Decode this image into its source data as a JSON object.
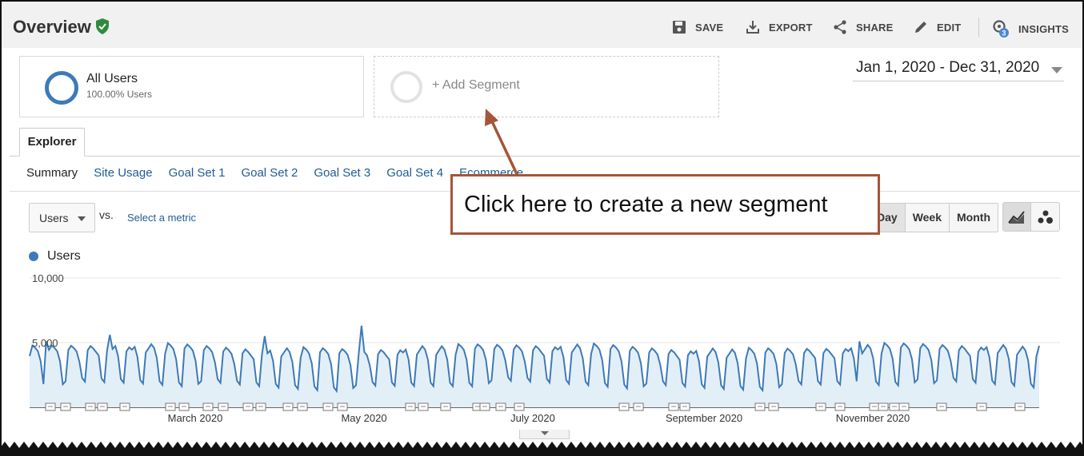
{
  "header": {
    "title": "Overview",
    "actions": [
      {
        "label": "SAVE",
        "icon": "save-icon"
      },
      {
        "label": "EXPORT",
        "icon": "export-icon"
      },
      {
        "label": "SHARE",
        "icon": "share-icon"
      },
      {
        "label": "EDIT",
        "icon": "edit-icon"
      },
      {
        "label": "INSIGHTS",
        "icon": "insights-icon",
        "badge": "3"
      }
    ]
  },
  "segments": {
    "active": {
      "name": "All Users",
      "percent": "100.00% Users"
    },
    "add_label": "+ Add Segment"
  },
  "date_range": "Jan 1, 2020 - Dec 31, 2020",
  "tabs": {
    "explorer": "Explorer",
    "subtabs": [
      "Summary",
      "Site Usage",
      "Goal Set 1",
      "Goal Set 2",
      "Goal Set 3",
      "Goal Set 4",
      "Ecommerce"
    ]
  },
  "metric": {
    "selected": "Users",
    "vs": "vs.",
    "select_metric": "Select a metric"
  },
  "period_buttons": [
    "Day",
    "Week",
    "Month"
  ],
  "callout": {
    "text": "Click here to create a new segment"
  },
  "colors": {
    "series": "#3d7ab8",
    "area": "#e3eff7",
    "callout_border": "#a5553a",
    "link": "#1f5b96",
    "verified": "#2e8b3d"
  },
  "chart_data": {
    "type": "area",
    "series": [
      {
        "name": "Users",
        "values": []
      }
    ],
    "y_ticks": [
      "10,000",
      "5,000"
    ],
    "ylim": [
      0,
      10000
    ],
    "x_labels": [
      "March 2020",
      "May 2020",
      "July 2020",
      "September 2020",
      "November 2020"
    ],
    "grid": true,
    "weekly_pattern": true
  }
}
